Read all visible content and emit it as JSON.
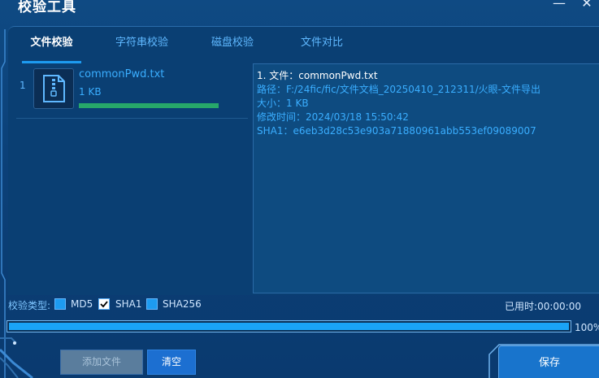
{
  "app": {
    "title": "校验工具"
  },
  "window_controls": {
    "minimize": "—",
    "close": "✕"
  },
  "tabs": [
    {
      "label": "文件校验",
      "active": true
    },
    {
      "label": "字符串校验",
      "active": false
    },
    {
      "label": "磁盘校验",
      "active": false
    },
    {
      "label": "文件对比",
      "active": false
    }
  ],
  "files": [
    {
      "index": "1",
      "name": "commonPwd.txt",
      "size": "1 KB",
      "progress": 100
    }
  ],
  "details": {
    "line1": "1. 文件：commonPwd.txt",
    "path": "路径：F:/24fic/fic/文件文档_20250410_212311/火眼-文件导出",
    "size": "大小：1 KB",
    "mtime": "修改时间：2024/03/18 15:50:42",
    "sha1": "SHA1：e6eb3d28c53e903a71880961abb553ef09089007"
  },
  "algorithms": {
    "label": "校验类型:",
    "options": [
      {
        "name": "MD5",
        "checked": false
      },
      {
        "name": "SHA1",
        "checked": true
      },
      {
        "name": "SHA256",
        "checked": false
      }
    ]
  },
  "elapsed": "已用时:00:00:00",
  "total_progress": {
    "percent": 100,
    "label": "100%"
  },
  "buttons": {
    "add_file": "添加文件",
    "clear": "清空",
    "save": "保存"
  },
  "colors": {
    "accent": "#1d9bf0",
    "progress_green": "#27a86a",
    "link_blue": "#3aaeff"
  }
}
